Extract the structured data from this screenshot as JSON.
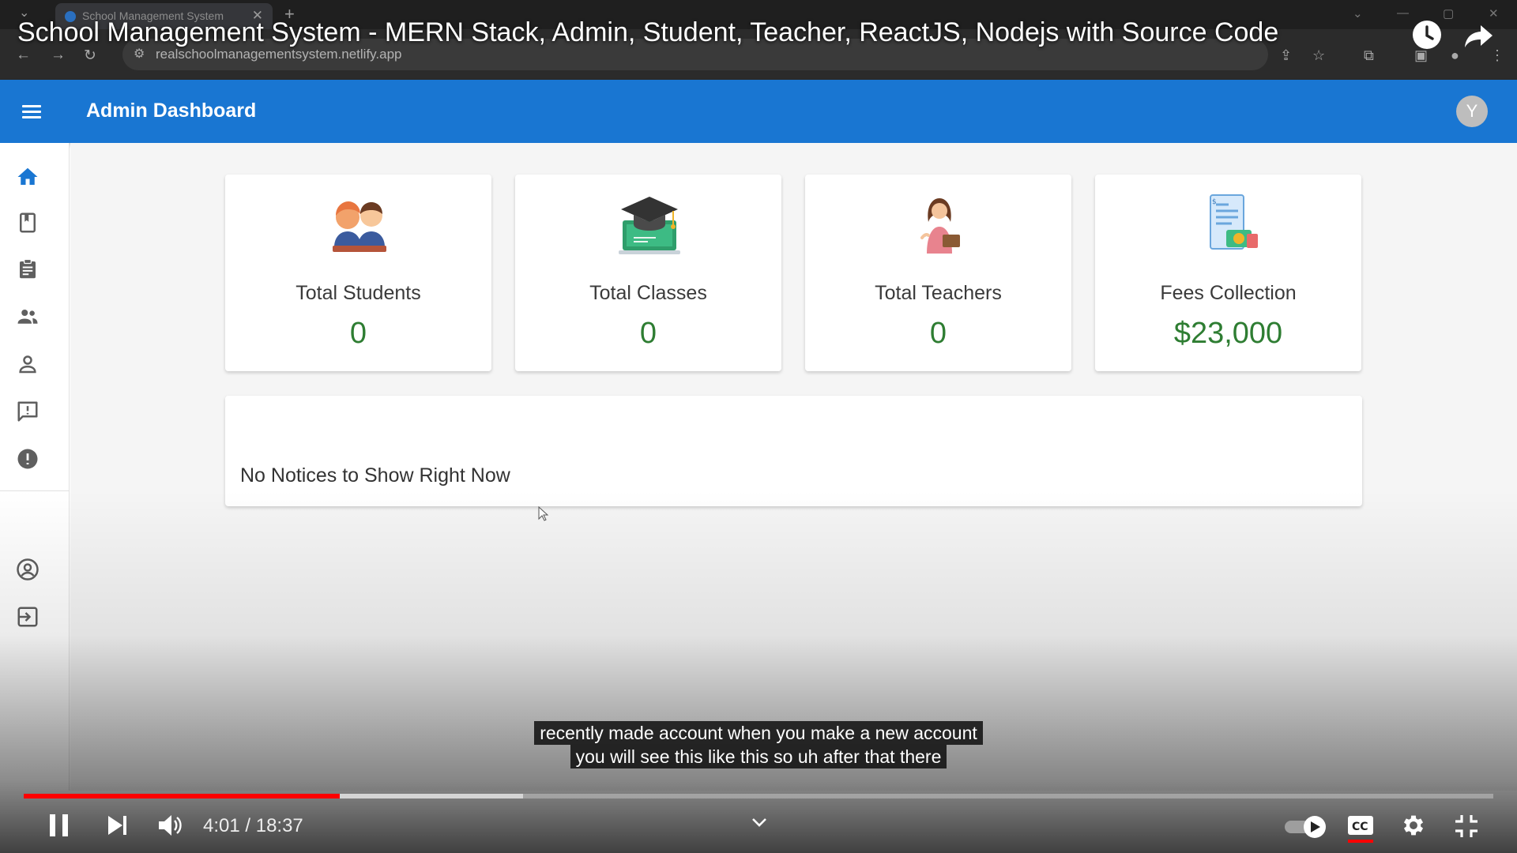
{
  "browser": {
    "tab_title": "School Management System",
    "url": "realschoolmanagementsystem.netlify.app"
  },
  "video": {
    "title": "School Management System - MERN Stack, Admin, Student, Teacher, ReactJS, Nodejs with Source Code",
    "caption_line_1": "recently made account when you make a new account",
    "caption_line_2": "you will see this like this so uh after that there",
    "current_time": "4:01",
    "duration": "18:37",
    "time_display": "4:01 / 18:37",
    "played_fraction": 0.215,
    "buffered_fraction": 0.34,
    "accent_color": "#ff0000"
  },
  "app": {
    "title": "Admin Dashboard",
    "avatar_letter": "Y",
    "primary_color": "#1976d2",
    "value_color": "#2e7d32"
  },
  "sidebar": {
    "items": [
      {
        "icon": "home-icon"
      },
      {
        "icon": "class-icon"
      },
      {
        "icon": "assignment-icon"
      },
      {
        "icon": "supervisor-icon"
      },
      {
        "icon": "person-outline-icon"
      },
      {
        "icon": "announcement-icon"
      },
      {
        "icon": "report-icon"
      },
      {
        "icon": "account-circle-icon"
      },
      {
        "icon": "exit-icon"
      }
    ]
  },
  "cards": [
    {
      "label": "Total Students",
      "value": "0",
      "icon": "students-illustration-icon"
    },
    {
      "label": "Total Classes",
      "value": "0",
      "icon": "graduation-cap-icon"
    },
    {
      "label": "Total Teachers",
      "value": "0",
      "icon": "teacher-illustration-icon"
    },
    {
      "label": "Fees Collection",
      "value": "$23,000",
      "icon": "fees-receipt-icon"
    }
  ],
  "notice": {
    "text": "No Notices to Show Right Now"
  }
}
